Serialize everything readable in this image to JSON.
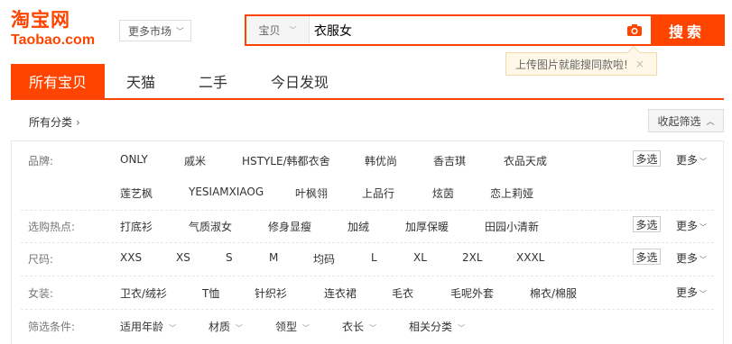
{
  "logo": {
    "cn": "淘宝网",
    "en": "Taobao.com"
  },
  "market": {
    "label": "更多市场"
  },
  "search": {
    "type": "宝贝",
    "value": "衣服女",
    "button": "搜索"
  },
  "tooltip": {
    "text": "上传图片就能搜同款啦!",
    "close": "×"
  },
  "tabs": [
    {
      "label": "所有宝贝"
    },
    {
      "label": "天猫"
    },
    {
      "label": "二手"
    },
    {
      "label": "今日发现"
    }
  ],
  "category_bar": {
    "all": "所有分类",
    "collapse": "收起筛选"
  },
  "filters": {
    "brand": {
      "label": "品牌:",
      "options": [
        "ONLY",
        "戚米",
        "HSTYLE/韩都衣舍",
        "韩优尚",
        "香吉琪",
        "衣品天成",
        "莲艺枫",
        "YESIAMXIAOG",
        "叶枫翎",
        "上品行",
        "炫茵",
        "恋上莉娅"
      ],
      "multi": "多选",
      "more": "更多"
    },
    "hot": {
      "label": "选购热点:",
      "options": [
        "打底衫",
        "气质淑女",
        "修身显瘦",
        "加绒",
        "加厚保暖",
        "田园小清新"
      ],
      "multi": "多选",
      "more": "更多"
    },
    "size": {
      "label": "尺码:",
      "options": [
        "XXS",
        "XS",
        "S",
        "M",
        "均码",
        "L",
        "XL",
        "2XL",
        "XXXL"
      ],
      "multi": "多选",
      "more": "更多"
    },
    "women": {
      "label": "女装:",
      "options": [
        "卫衣/绒衫",
        "T恤",
        "针织衫",
        "连衣裙",
        "毛衣",
        "毛呢外套",
        "棉衣/棉服"
      ],
      "more": "更多"
    },
    "conditions": {
      "label": "筛选条件:",
      "options": [
        "适用年龄",
        "材质",
        "领型",
        "衣长",
        "相关分类"
      ]
    }
  },
  "colors": {
    "accent": "#ff4400",
    "tooltip_bg": "#fff8e8"
  }
}
